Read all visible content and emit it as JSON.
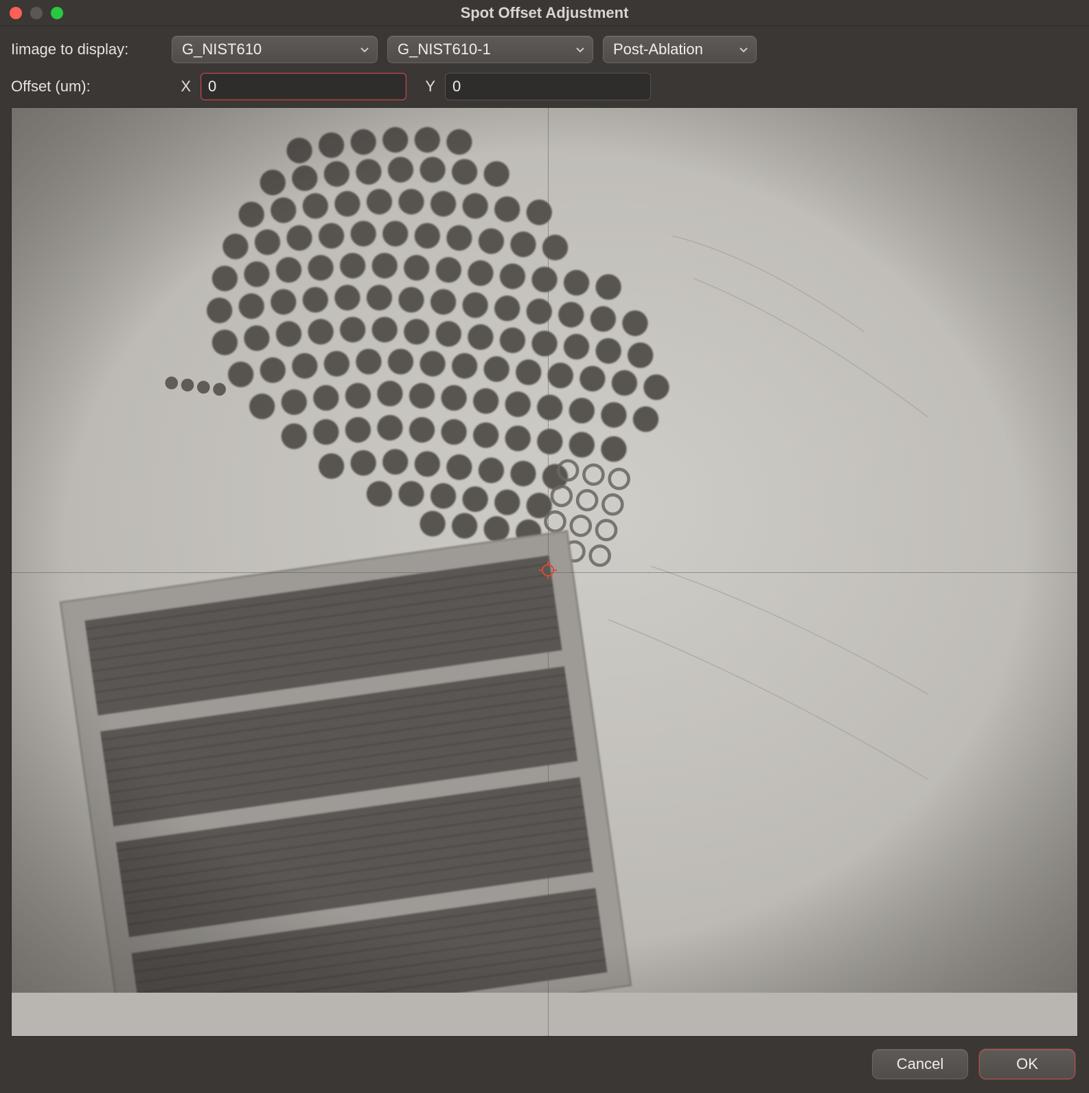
{
  "window": {
    "title": "Spot Offset Adjustment"
  },
  "controls": {
    "image_to_display_label": "Iimage to display:",
    "select_image": "G_NIST610",
    "select_sub": "G_NIST610-1",
    "select_mode": "Post-Ablation",
    "offset_label": "Offset (um):",
    "x_label": "X",
    "y_label": "Y",
    "x_value": "0",
    "y_value": "0"
  },
  "buttons": {
    "cancel": "Cancel",
    "ok": "OK"
  },
  "colors": {
    "accent_red": "#c24a44"
  },
  "icons": {
    "caret": "chevron-down-icon",
    "reticle": "target-icon"
  }
}
